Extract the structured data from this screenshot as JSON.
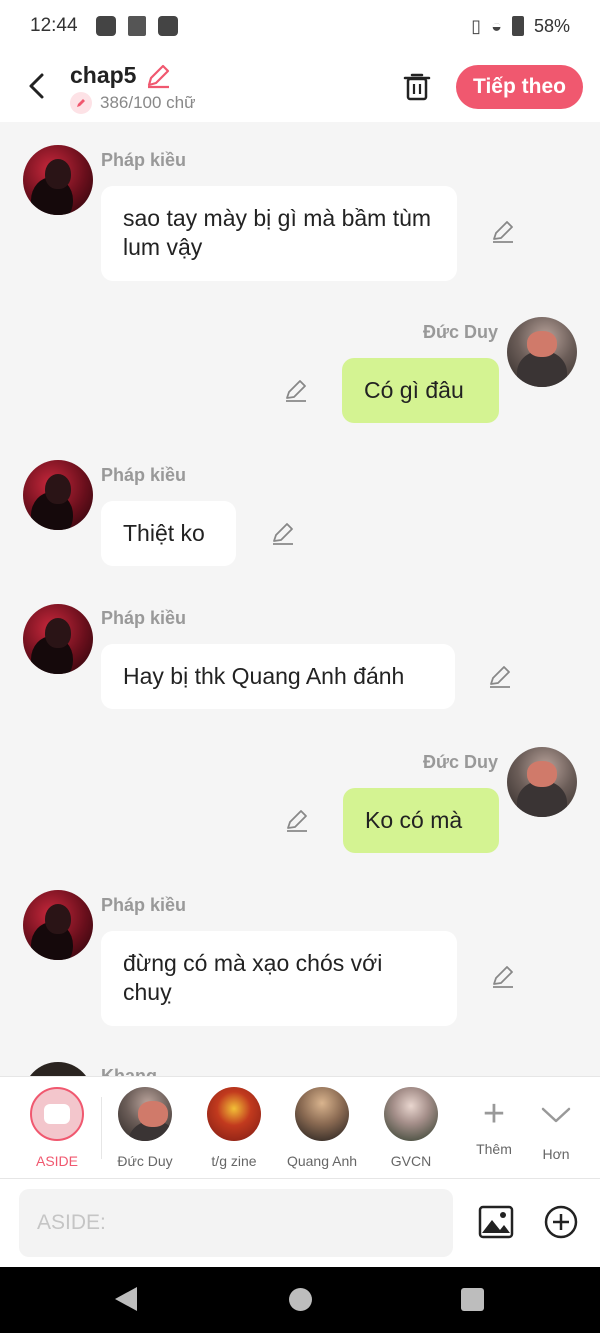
{
  "status_bar": {
    "time": "12:44",
    "battery": "58%"
  },
  "header": {
    "title": "chap5",
    "word_count": "386/100 chữ",
    "next_button": "Tiếp theo"
  },
  "messages": [
    {
      "sender": "Pháp kiều",
      "text": "sao tay mày bị gì mà bầm tùm lum vậy",
      "side": "left"
    },
    {
      "sender": "Đức Duy",
      "text": "Có gì đâu",
      "side": "right"
    },
    {
      "sender": "Pháp kiều",
      "text": "Thiệt ko",
      "side": "left"
    },
    {
      "sender": "Pháp kiều",
      "text": "Hay bị thk Quang Anh đánh",
      "side": "left"
    },
    {
      "sender": "Đức Duy",
      "text": "Ko có mà",
      "side": "right"
    },
    {
      "sender": "Pháp kiều",
      "text": "đừng có mà xạo chós với chuỵ",
      "side": "left"
    },
    {
      "sender": "Khang",
      "text": "",
      "side": "left"
    }
  ],
  "characters": [
    {
      "label": "ASIDE"
    },
    {
      "label": "Đức Duy"
    },
    {
      "label": "t/g zine"
    },
    {
      "label": "Quang Anh"
    },
    {
      "label": "GVCN"
    },
    {
      "label": "Thêm"
    },
    {
      "label": "Hơn"
    }
  ],
  "input": {
    "placeholder": "ASIDE:"
  }
}
